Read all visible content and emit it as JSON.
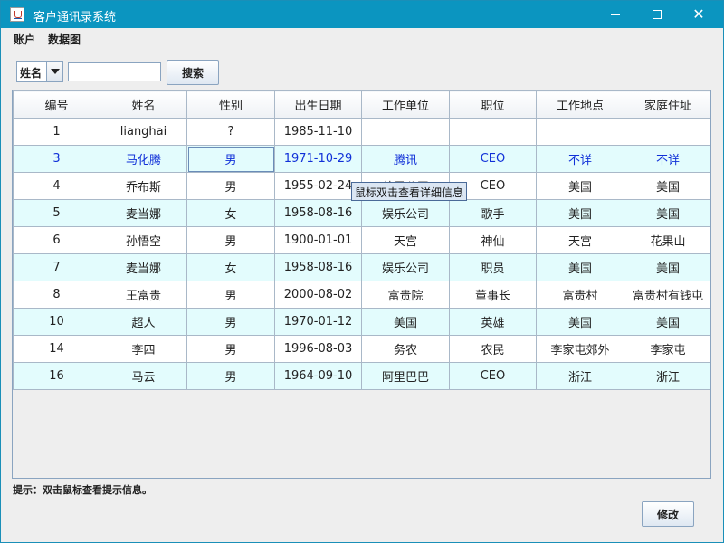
{
  "window": {
    "title": "客户通讯录系统"
  },
  "menu": [
    "账户",
    "数据图"
  ],
  "search": {
    "field_selected": "姓名",
    "query": "",
    "button_label": "搜索"
  },
  "table": {
    "columns": [
      "编号",
      "姓名",
      "性别",
      "出生日期",
      "工作单位",
      "职位",
      "工作地点",
      "家庭住址"
    ],
    "rows": [
      [
        "1",
        "lianghai",
        "?",
        "1985-11-10",
        "",
        "",
        "",
        ""
      ],
      [
        "3",
        "马化腾",
        "男",
        "1971-10-29",
        "腾讯",
        "CEO",
        "不详",
        "不详"
      ],
      [
        "4",
        "乔布斯",
        "男",
        "1955-02-24",
        "苹果公司",
        "CEO",
        "美国",
        "美国"
      ],
      [
        "5",
        "麦当娜",
        "女",
        "1958-08-16",
        "娱乐公司",
        "歌手",
        "美国",
        "美国"
      ],
      [
        "6",
        "孙悟空",
        "男",
        "1900-01-01",
        "天宫",
        "神仙",
        "天宫",
        "花果山"
      ],
      [
        "7",
        "麦当娜",
        "女",
        "1958-08-16",
        "娱乐公司",
        "职员",
        "美国",
        "美国"
      ],
      [
        "8",
        "王富贵",
        "男",
        "2000-08-02",
        "富贵院",
        "董事长",
        "富贵村",
        "富贵村有钱屯"
      ],
      [
        "10",
        "超人",
        "男",
        "1970-01-12",
        "美国",
        "英雄",
        "美国",
        "美国"
      ],
      [
        "14",
        "李四",
        "男",
        "1996-08-03",
        "务农",
        "农民",
        "李家屯郊外",
        "李家屯"
      ],
      [
        "16",
        "马云",
        "男",
        "1964-09-10",
        "阿里巴巴",
        "CEO",
        "浙江",
        "浙江"
      ]
    ],
    "selected_row": 1
  },
  "tooltip": "鼠标双击查看详细信息",
  "hint": "提示：双击鼠标查看提示信息。",
  "edit_button_label": "修改"
}
